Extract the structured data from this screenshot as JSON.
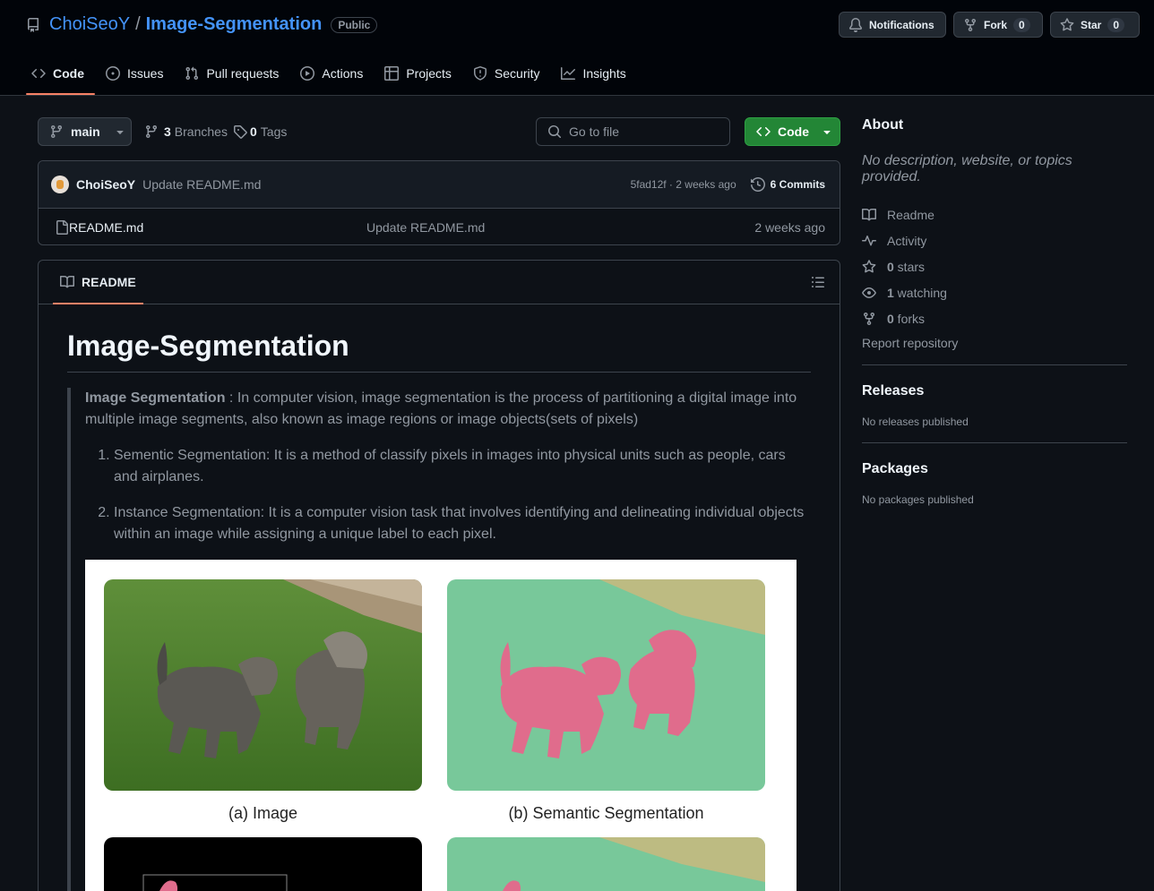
{
  "repo": {
    "owner": "ChoiSeoY",
    "separator": "/",
    "name": "Image-Segmentation",
    "visibility": "Public"
  },
  "header_buttons": {
    "notifications": "Notifications",
    "fork": "Fork",
    "fork_count": "0",
    "star": "Star",
    "star_count": "0"
  },
  "tabs": [
    {
      "label": "Code",
      "icon": "code-icon",
      "active": true
    },
    {
      "label": "Issues",
      "icon": "issue-icon"
    },
    {
      "label": "Pull requests",
      "icon": "pull-request-icon"
    },
    {
      "label": "Actions",
      "icon": "play-icon"
    },
    {
      "label": "Projects",
      "icon": "table-icon"
    },
    {
      "label": "Security",
      "icon": "shield-icon"
    },
    {
      "label": "Insights",
      "icon": "graph-icon"
    }
  ],
  "toolbar": {
    "branch": "main",
    "branches_count": "3",
    "branches_label": "Branches",
    "tags_count": "0",
    "tags_label": "Tags",
    "search_placeholder": "Go to file",
    "code_button": "Code"
  },
  "latest_commit": {
    "author": "ChoiSeoY",
    "message": "Update README.md",
    "meta": "5fad12f · 2 weeks ago",
    "commits_label": "6 Commits"
  },
  "files": [
    {
      "name": "README.md",
      "commit": "Update README.md",
      "date": "2 weeks ago"
    }
  ],
  "readme": {
    "tab_label": "README",
    "title": "Image-Segmentation",
    "intro_bold": "Image Segmentation",
    "intro_text": " : In computer vision, image segmentation is the process of partitioning a digital image into multiple image segments, also known as image regions or image objects(sets of pixels)",
    "list": [
      "Sementic Segmentation: It is a method of classify pixels in images into physical units such as people, cars and airplanes.",
      "Instance Segmentation: It is a computer vision task that involves identifying and delineating individual objects within an image while assigning a unique label to each pixel."
    ],
    "figure_captions": [
      "(a) Image",
      "(b) Semantic Segmentation"
    ]
  },
  "sidebar": {
    "about_title": "About",
    "about_desc": "No description, website, or topics provided.",
    "items": [
      {
        "icon": "book-icon",
        "count": "",
        "label": "Readme"
      },
      {
        "icon": "pulse-icon",
        "count": "",
        "label": "Activity"
      },
      {
        "icon": "star-icon",
        "count": "0",
        "label": " stars"
      },
      {
        "icon": "eye-icon",
        "count": "1",
        "label": " watching"
      },
      {
        "icon": "fork-icon",
        "count": "0",
        "label": " forks"
      }
    ],
    "report": "Report repository",
    "releases_title": "Releases",
    "releases_text": "No releases published",
    "packages_title": "Packages",
    "packages_text": "No packages published"
  },
  "colors": {
    "background": "#0d1117",
    "header_bg": "#010409",
    "link": "#4493f8",
    "accent_underline": "#f78166",
    "primary_button": "#238636",
    "border": "#3d444d",
    "muted_text": "#9198a1"
  }
}
